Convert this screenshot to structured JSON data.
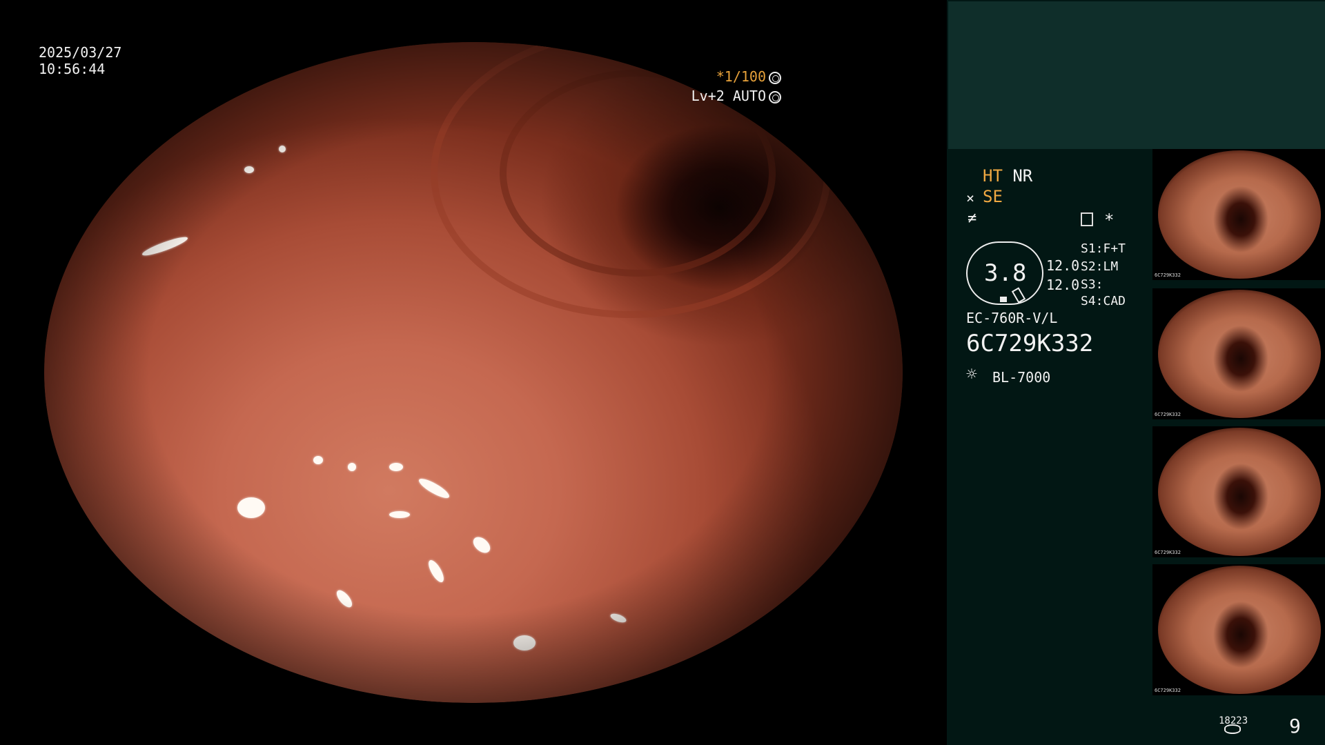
{
  "overlay": {
    "date": "2025/03/27",
    "time": "10:56:44",
    "shutter": "*1/100",
    "level": "Lv+2 AUTO"
  },
  "settings": {
    "ht": "HT",
    "nr": "NR",
    "se": "SE",
    "gauge_value": "3.8",
    "values": [
      "12.0",
      "12.0"
    ],
    "s_labels": [
      "S1:F+T",
      "S2:LM",
      "S3:",
      "S4:CAD"
    ],
    "scope_model": "EC-760R-V/L",
    "serial": "6C729K332",
    "light_source": "BL-7000",
    "star": "*"
  },
  "thumbnails": [
    {
      "caption": "6C729K332"
    },
    {
      "caption": "6C729K332"
    },
    {
      "caption": "6C729K332"
    },
    {
      "caption": "6C729K332"
    }
  ],
  "footer": {
    "count": "18223",
    "page": "9"
  },
  "icons": [
    "shutter-rotate-icon",
    "auto-iris-icon",
    "se-wave-icon",
    "f-icon",
    "menu-icon",
    "sun-icon",
    "database-icon"
  ]
}
